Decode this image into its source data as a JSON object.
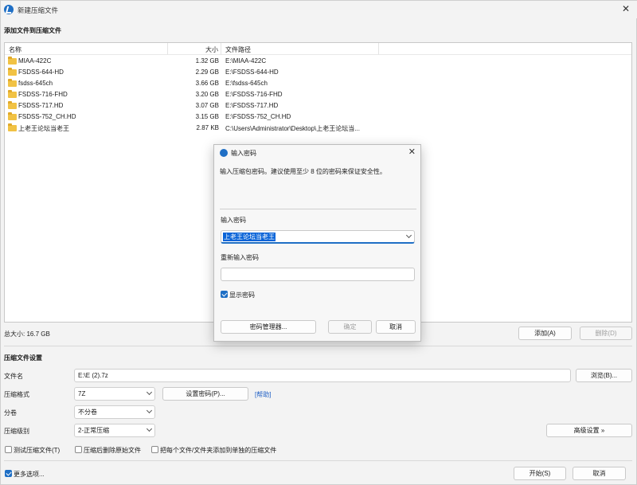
{
  "window": {
    "title": "新建压缩文件"
  },
  "files_section": {
    "label": "添加文件到压缩文件"
  },
  "file_list": {
    "columns": {
      "name": "名称",
      "size": "大小",
      "path": "文件路径"
    },
    "rows": [
      {
        "name": "MIAA-422C",
        "size": "1.32 GB",
        "path": "E:\\MIAA-422C"
      },
      {
        "name": "FSDSS-644-HD",
        "size": "2.29 GB",
        "path": "E:\\FSDSS-644-HD"
      },
      {
        "name": "fsdss-645ch",
        "size": "3.66 GB",
        "path": "E:\\fsdss-645ch"
      },
      {
        "name": "FSDSS-716-FHD",
        "size": "3.20 GB",
        "path": "E:\\FSDSS-716-FHD"
      },
      {
        "name": "FSDSS-717.HD",
        "size": "3.07 GB",
        "path": "E:\\FSDSS-717.HD"
      },
      {
        "name": "FSDSS-752_CH.HD",
        "size": "3.15 GB",
        "path": "E:\\FSDSS-752_CH.HD"
      },
      {
        "name": "上老王论坛当老王",
        "size": "2.87 KB",
        "path": "C:\\Users\\Administrator\\Desktop\\上老王论坛当..."
      }
    ]
  },
  "total_size": "总大小: 16.7 GB",
  "buttons": {
    "add": "添加(A)",
    "remove": "删除(D)",
    "browse": "浏览(B)...",
    "set_password": "设置密码(P)...",
    "help": "[帮助]",
    "advanced": "高级设置 »",
    "start": "开始(S)",
    "cancel": "取消"
  },
  "settings": {
    "label": "压缩文件设置",
    "filename_label": "文件名",
    "filename_value": "E:\\E (2).7z",
    "format_label": "压缩格式",
    "format_value": "7Z",
    "volume_label": "分卷",
    "volume_value": "不分卷",
    "level_label": "压缩级别",
    "level_value": "2-正常压缩"
  },
  "options": {
    "test": "测试压缩文件(T)",
    "delete_after": "压缩后删除原始文件",
    "separate": "把每个文件/文件夹添加到单独的压缩文件",
    "more": "更多选项..."
  },
  "dialog": {
    "title": "输入密码",
    "description": "输入压缩包密码。建议使用至少 8 位的密码来保证安全性。",
    "password_label": "输入密码",
    "password_value": "上老王论坛当老王",
    "reenter_label": "重新输入密码",
    "reenter_value": "",
    "show_password": "显示密码",
    "password_manager": "密码管理器...",
    "ok": "确定",
    "cancel": "取消"
  }
}
